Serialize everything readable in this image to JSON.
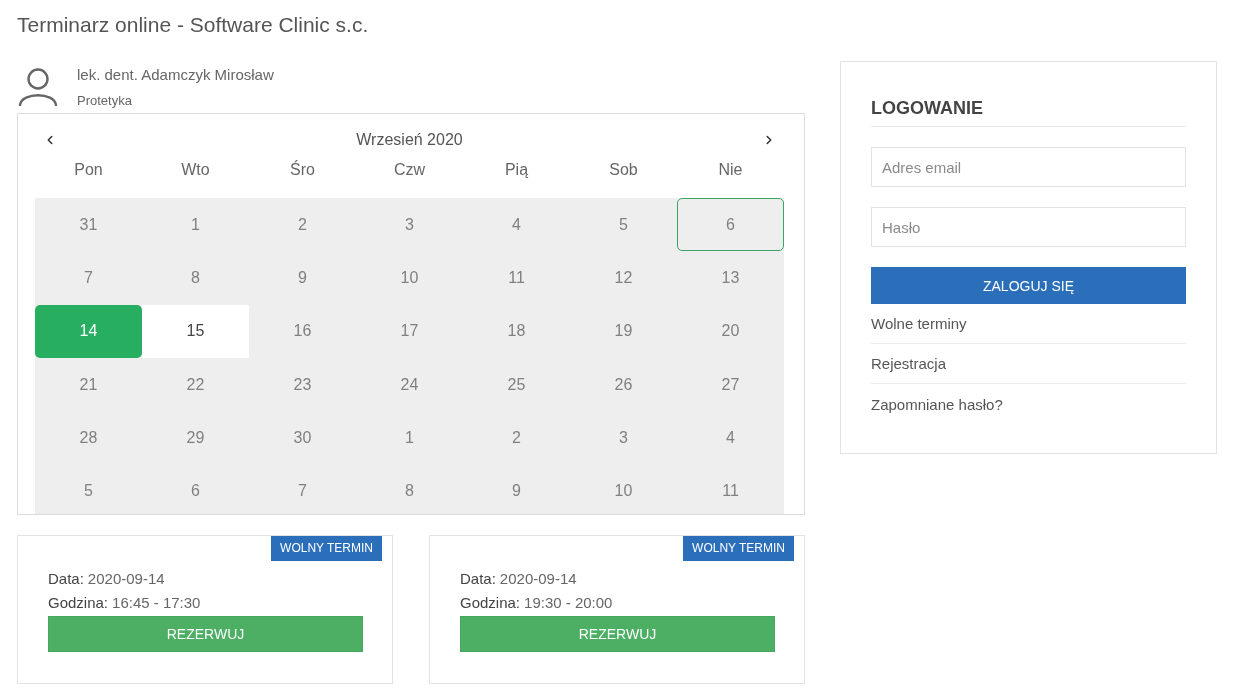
{
  "page_title": "Terminarz online - Software Clinic s.c.",
  "doctor": {
    "name": "lek. dent. Adamczyk Mirosław",
    "specialty": "Protetyka"
  },
  "calendar": {
    "month": "Wrzesień 2020",
    "weekdays": [
      "Pon",
      "Wto",
      "Śro",
      "Czw",
      "Pią",
      "Sob",
      "Nie"
    ],
    "weeks": [
      [
        {
          "label": "31",
          "selected": false,
          "available": false,
          "today": false
        },
        {
          "label": "1",
          "selected": false,
          "available": false,
          "today": false
        },
        {
          "label": "2",
          "selected": false,
          "available": false,
          "today": false
        },
        {
          "label": "3",
          "selected": false,
          "available": false,
          "today": false
        },
        {
          "label": "4",
          "selected": false,
          "available": false,
          "today": false
        },
        {
          "label": "5",
          "selected": false,
          "available": false,
          "today": false
        },
        {
          "label": "6",
          "selected": false,
          "available": false,
          "today": true
        }
      ],
      [
        {
          "label": "7",
          "selected": false,
          "available": false,
          "today": false
        },
        {
          "label": "8",
          "selected": false,
          "available": false,
          "today": false
        },
        {
          "label": "9",
          "selected": false,
          "available": false,
          "today": false
        },
        {
          "label": "10",
          "selected": false,
          "available": false,
          "today": false
        },
        {
          "label": "11",
          "selected": false,
          "available": false,
          "today": false
        },
        {
          "label": "12",
          "selected": false,
          "available": false,
          "today": false
        },
        {
          "label": "13",
          "selected": false,
          "available": false,
          "today": false
        }
      ],
      [
        {
          "label": "14",
          "selected": true,
          "available": true,
          "today": false
        },
        {
          "label": "15",
          "selected": false,
          "available": true,
          "today": false
        },
        {
          "label": "16",
          "selected": false,
          "available": false,
          "today": false
        },
        {
          "label": "17",
          "selected": false,
          "available": false,
          "today": false
        },
        {
          "label": "18",
          "selected": false,
          "available": false,
          "today": false
        },
        {
          "label": "19",
          "selected": false,
          "available": false,
          "today": false
        },
        {
          "label": "20",
          "selected": false,
          "available": false,
          "today": false
        }
      ],
      [
        {
          "label": "21",
          "selected": false,
          "available": false,
          "today": false
        },
        {
          "label": "22",
          "selected": false,
          "available": false,
          "today": false
        },
        {
          "label": "23",
          "selected": false,
          "available": false,
          "today": false
        },
        {
          "label": "24",
          "selected": false,
          "available": false,
          "today": false
        },
        {
          "label": "25",
          "selected": false,
          "available": false,
          "today": false
        },
        {
          "label": "26",
          "selected": false,
          "available": false,
          "today": false
        },
        {
          "label": "27",
          "selected": false,
          "available": false,
          "today": false
        }
      ],
      [
        {
          "label": "28",
          "selected": false,
          "available": false,
          "today": false
        },
        {
          "label": "29",
          "selected": false,
          "available": false,
          "today": false
        },
        {
          "label": "30",
          "selected": false,
          "available": false,
          "today": false
        },
        {
          "label": "1",
          "selected": false,
          "available": false,
          "today": false
        },
        {
          "label": "2",
          "selected": false,
          "available": false,
          "today": false
        },
        {
          "label": "3",
          "selected": false,
          "available": false,
          "today": false
        },
        {
          "label": "4",
          "selected": false,
          "available": false,
          "today": false
        }
      ],
      [
        {
          "label": "5",
          "selected": false,
          "available": false,
          "today": false
        },
        {
          "label": "6",
          "selected": false,
          "available": false,
          "today": false
        },
        {
          "label": "7",
          "selected": false,
          "available": false,
          "today": false
        },
        {
          "label": "8",
          "selected": false,
          "available": false,
          "today": false
        },
        {
          "label": "9",
          "selected": false,
          "available": false,
          "today": false
        },
        {
          "label": "10",
          "selected": false,
          "available": false,
          "today": false
        },
        {
          "label": "11",
          "selected": false,
          "available": false,
          "today": false
        }
      ]
    ]
  },
  "slots": [
    {
      "badge": "WOLNY TERMIN",
      "date_label": "Data:",
      "date": "2020-09-14",
      "time_label": "Godzina:",
      "time": "16:45 - 17:30",
      "button": "REZERWUJ"
    },
    {
      "badge": "WOLNY TERMIN",
      "date_label": "Data:",
      "date": "2020-09-14",
      "time_label": "Godzina:",
      "time": "19:30 - 20:00",
      "button": "REZERWUJ"
    }
  ],
  "login": {
    "title": "LOGOWANIE",
    "email": {
      "placeholder": "Adres email"
    },
    "password": {
      "placeholder": "Hasło"
    },
    "submit": "ZALOGUJ SIĘ",
    "links": [
      "Wolne terminy",
      "Rejestracja",
      "Zapomniane hasło?"
    ]
  }
}
